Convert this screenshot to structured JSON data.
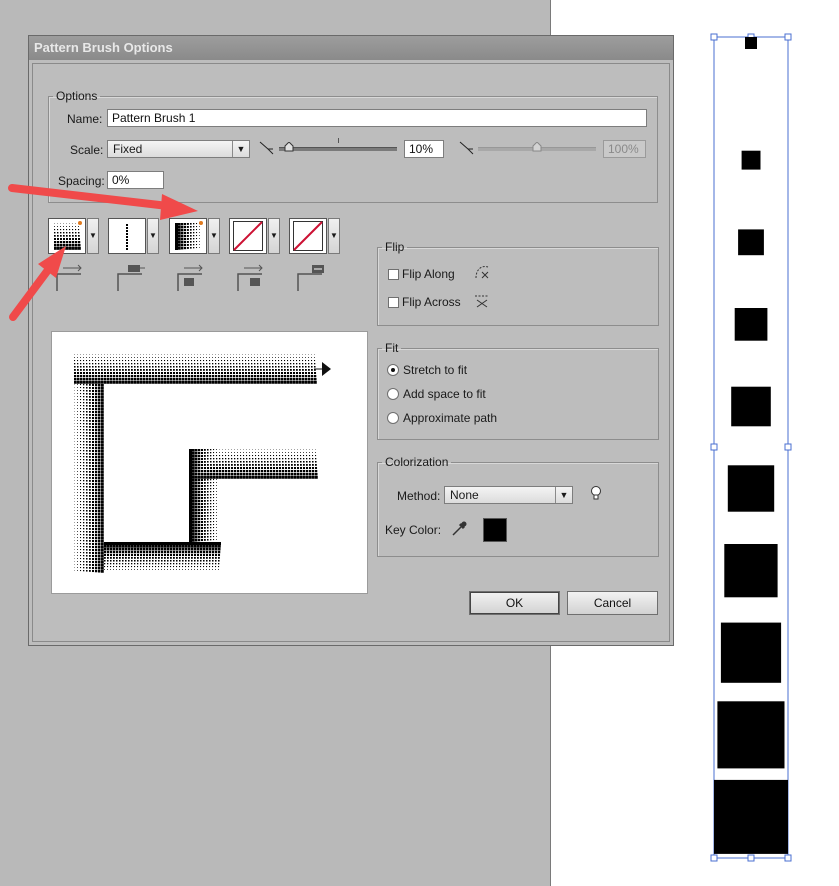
{
  "dialog": {
    "title": "Pattern Brush Options",
    "options_legend": "Options",
    "name_label": "Name:",
    "name_value": "Pattern Brush 1",
    "scale_label": "Scale:",
    "scale_value": "Fixed",
    "scale_percent": "10%",
    "scale_percent_max": "100%",
    "spacing_label": "Spacing:",
    "spacing_value": "0%",
    "flip": {
      "legend": "Flip",
      "along_label": "Flip Along",
      "across_label": "Flip Across"
    },
    "fit": {
      "legend": "Fit",
      "options": [
        "Stretch to fit",
        "Add space to fit",
        "Approximate path"
      ],
      "selected": 0
    },
    "colorization": {
      "legend": "Colorization",
      "method_label": "Method:",
      "method_value": "None",
      "key_color_label": "Key Color:",
      "key_color": "#000000"
    },
    "ok_label": "OK",
    "cancel_label": "Cancel"
  },
  "tiles": [
    {
      "name": "outer-corner-tile"
    },
    {
      "name": "side-tile"
    },
    {
      "name": "inner-corner-tile"
    },
    {
      "name": "start-tile"
    },
    {
      "name": "end-tile"
    }
  ],
  "colors": {
    "annotation_arrow": "#f04a4a",
    "selection": "#4a6fd0",
    "none_swatch_line": "#cc1133",
    "accent_dot": "#e07a1f"
  },
  "artboard_squares_count": 10
}
